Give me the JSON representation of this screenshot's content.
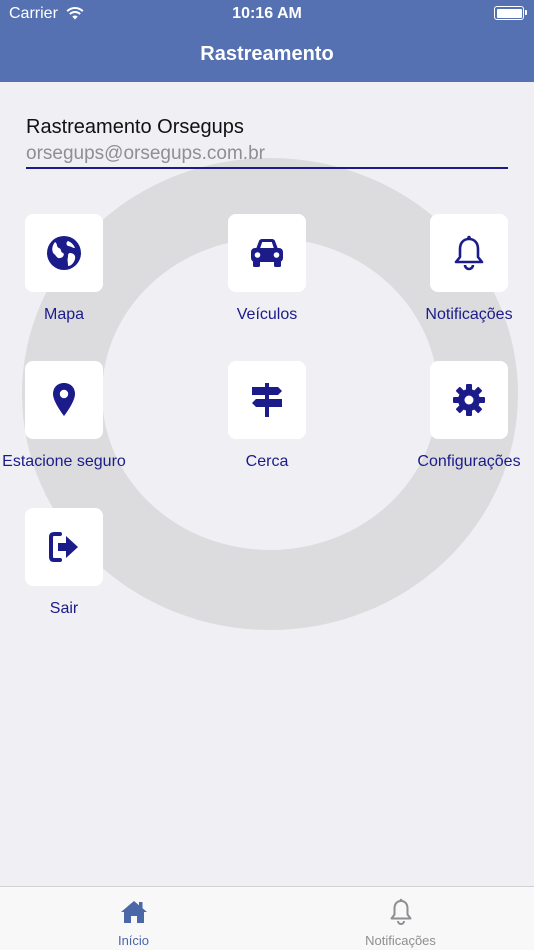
{
  "status_bar": {
    "carrier": "Carrier",
    "time": "10:16 AM"
  },
  "nav": {
    "title": "Rastreamento"
  },
  "account": {
    "name": "Rastreamento Orsegups",
    "email": "orsegups@orsegups.com.br"
  },
  "menu": {
    "items": [
      {
        "label": "Mapa",
        "icon": "globe-icon"
      },
      {
        "label": "Veículos",
        "icon": "car-icon"
      },
      {
        "label": "Notificações",
        "icon": "bell-icon"
      },
      {
        "label": "Estacione seguro",
        "icon": "location-pin-icon"
      },
      {
        "label": "Cerca",
        "icon": "signpost-icon"
      },
      {
        "label": "Configurações",
        "icon": "gear-icon"
      },
      {
        "label": "Sair",
        "icon": "sign-out-icon"
      }
    ]
  },
  "tabbar": {
    "tabs": [
      {
        "label": "Início",
        "icon": "home-icon",
        "active": true
      },
      {
        "label": "Notificações",
        "icon": "bell-icon",
        "active": false
      }
    ]
  },
  "colors": {
    "header": "#5571b1",
    "accent": "#1b1b8a",
    "background": "#efeff4",
    "tab_active": "#4a67a8",
    "tab_inactive": "#8e8e93"
  }
}
